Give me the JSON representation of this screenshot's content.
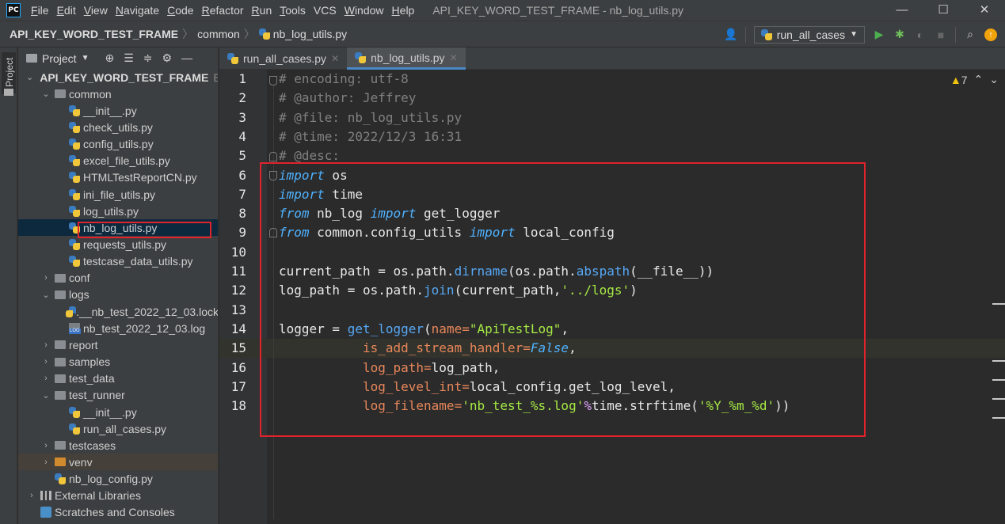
{
  "menubar": {
    "logo": "PC",
    "menus": [
      {
        "u": "F",
        "rest": "ile"
      },
      {
        "u": "E",
        "rest": "dit"
      },
      {
        "u": "V",
        "rest": "iew"
      },
      {
        "u": "N",
        "rest": "avigate"
      },
      {
        "u": "C",
        "rest": "ode"
      },
      {
        "u": "R",
        "rest": "efactor"
      },
      {
        "u": "R",
        "rest": "un"
      },
      {
        "u": "T",
        "rest": "ools"
      },
      {
        "u": "",
        "rest": "VCS"
      },
      {
        "u": "W",
        "rest": "indow"
      },
      {
        "u": "H",
        "rest": "elp"
      }
    ],
    "title": "API_KEY_WORD_TEST_FRAME - nb_log_utils.py",
    "controls": {
      "minimize": "—",
      "maximize": "☐",
      "close": "✕"
    }
  },
  "navbar": {
    "project": "API_KEY_WORD_TEST_FRAME",
    "folder": "common",
    "file": "nb_log_utils.py",
    "run_config": "run_all_cases"
  },
  "stripe": {
    "label": "Project"
  },
  "project_panel": {
    "title": "Project",
    "tree": [
      {
        "indent": 0,
        "arrow": "⌄",
        "icon": "folder",
        "label": "API_KEY_WORD_TEST_FRAME",
        "suffix": "E:",
        "bold": true
      },
      {
        "indent": 1,
        "arrow": "⌄",
        "icon": "folder",
        "label": "common"
      },
      {
        "indent": 2,
        "arrow": "",
        "icon": "py",
        "label": "__init__.py"
      },
      {
        "indent": 2,
        "arrow": "",
        "icon": "py",
        "label": "check_utils.py"
      },
      {
        "indent": 2,
        "arrow": "",
        "icon": "py",
        "label": "config_utils.py"
      },
      {
        "indent": 2,
        "arrow": "",
        "icon": "py",
        "label": "excel_file_utils.py"
      },
      {
        "indent": 2,
        "arrow": "",
        "icon": "py",
        "label": "HTMLTestReportCN.py"
      },
      {
        "indent": 2,
        "arrow": "",
        "icon": "py",
        "label": "ini_file_utils.py"
      },
      {
        "indent": 2,
        "arrow": "",
        "icon": "py",
        "label": "log_utils.py"
      },
      {
        "indent": 2,
        "arrow": "",
        "icon": "py",
        "label": "nb_log_utils.py",
        "selected": true
      },
      {
        "indent": 2,
        "arrow": "",
        "icon": "py",
        "label": "requests_utils.py"
      },
      {
        "indent": 2,
        "arrow": "",
        "icon": "py",
        "label": "testcase_data_utils.py"
      },
      {
        "indent": 1,
        "arrow": "›",
        "icon": "folder",
        "label": "conf"
      },
      {
        "indent": 1,
        "arrow": "⌄",
        "icon": "folder",
        "label": "logs"
      },
      {
        "indent": 2,
        "arrow": "",
        "icon": "py",
        "label": ".__nb_test_2022_12_03.lock"
      },
      {
        "indent": 2,
        "arrow": "",
        "icon": "log",
        "label": "nb_test_2022_12_03.log"
      },
      {
        "indent": 1,
        "arrow": "›",
        "icon": "folder",
        "label": "report"
      },
      {
        "indent": 1,
        "arrow": "›",
        "icon": "folder",
        "label": "samples"
      },
      {
        "indent": 1,
        "arrow": "›",
        "icon": "folder",
        "label": "test_data"
      },
      {
        "indent": 1,
        "arrow": "⌄",
        "icon": "folder",
        "label": "test_runner"
      },
      {
        "indent": 2,
        "arrow": "",
        "icon": "py",
        "label": "__init__.py"
      },
      {
        "indent": 2,
        "arrow": "",
        "icon": "py",
        "label": "run_all_cases.py"
      },
      {
        "indent": 1,
        "arrow": "›",
        "icon": "folder",
        "label": "testcases"
      },
      {
        "indent": 1,
        "arrow": "›",
        "icon": "folder-orange",
        "label": "venv",
        "venv": true
      },
      {
        "indent": 1,
        "arrow": "",
        "icon": "py",
        "label": "nb_log_config.py"
      },
      {
        "indent": 0,
        "arrow": "›",
        "icon": "libs",
        "label": "External Libraries"
      },
      {
        "indent": 0,
        "arrow": "",
        "icon": "scratch",
        "label": "Scratches and Consoles"
      }
    ]
  },
  "tabs": [
    {
      "label": "run_all_cases.py",
      "active": false
    },
    {
      "label": "nb_log_utils.py",
      "active": true
    }
  ],
  "editor": {
    "warnings": "7",
    "lines": [
      [
        {
          "t": "cmt",
          "v": "# encoding: utf-8"
        }
      ],
      [
        {
          "t": "cmt",
          "v": "# @author: Jeffrey"
        }
      ],
      [
        {
          "t": "cmt",
          "v": "# @file: nb_log_utils.py"
        }
      ],
      [
        {
          "t": "cmt",
          "v": "# @time: 2022/12/3 16:31"
        }
      ],
      [
        {
          "t": "cmt",
          "v": "# @desc:"
        }
      ],
      [
        {
          "t": "kw",
          "v": "import"
        },
        {
          "t": "",
          "v": " os"
        }
      ],
      [
        {
          "t": "kw",
          "v": "import"
        },
        {
          "t": "",
          "v": " time"
        }
      ],
      [
        {
          "t": "kw",
          "v": "from"
        },
        {
          "t": "",
          "v": " nb_log "
        },
        {
          "t": "kw",
          "v": "import"
        },
        {
          "t": "",
          "v": " get_logger"
        }
      ],
      [
        {
          "t": "kw",
          "v": "from"
        },
        {
          "t": "",
          "v": " common.config_utils "
        },
        {
          "t": "kw",
          "v": "import"
        },
        {
          "t": "",
          "v": " local_config"
        }
      ],
      [],
      [
        {
          "t": "",
          "v": "current_path = os.path."
        },
        {
          "t": "fn",
          "v": "dirname"
        },
        {
          "t": "",
          "v": "(os.path."
        },
        {
          "t": "fn",
          "v": "abspath"
        },
        {
          "t": "",
          "v": "(__file__))"
        }
      ],
      [
        {
          "t": "",
          "v": "log_path = os.path."
        },
        {
          "t": "fn",
          "v": "join"
        },
        {
          "t": "",
          "v": "(current_path,"
        },
        {
          "t": "str",
          "v": "'../logs'"
        },
        {
          "t": "",
          "v": ")"
        }
      ],
      [],
      [
        {
          "t": "",
          "v": "logger = "
        },
        {
          "t": "fn",
          "v": "get_logger"
        },
        {
          "t": "",
          "v": "("
        },
        {
          "t": "param",
          "v": "name="
        },
        {
          "t": "str",
          "v": "\"ApiTestLog\""
        },
        {
          "t": "",
          "v": ","
        }
      ],
      [
        {
          "t": "",
          "v": "           "
        },
        {
          "t": "param",
          "v": "is_add_stream_handler="
        },
        {
          "t": "kw",
          "v": "False"
        },
        {
          "t": "",
          "v": ","
        }
      ],
      [
        {
          "t": "",
          "v": "           "
        },
        {
          "t": "param",
          "v": "log_path="
        },
        {
          "t": "",
          "v": "log_path,"
        }
      ],
      [
        {
          "t": "",
          "v": "           "
        },
        {
          "t": "param",
          "v": "log_level_int="
        },
        {
          "t": "",
          "v": "local_config.get_log_level,"
        }
      ],
      [
        {
          "t": "",
          "v": "           "
        },
        {
          "t": "param",
          "v": "log_filename="
        },
        {
          "t": "str",
          "v": "'nb_test_%s.log'"
        },
        {
          "t": "pct",
          "v": "%"
        },
        {
          "t": "",
          "v": "time.strftime("
        },
        {
          "t": "str",
          "v": "'%Y_%m_%d'"
        },
        {
          "t": "",
          "v": "))"
        }
      ]
    ]
  }
}
